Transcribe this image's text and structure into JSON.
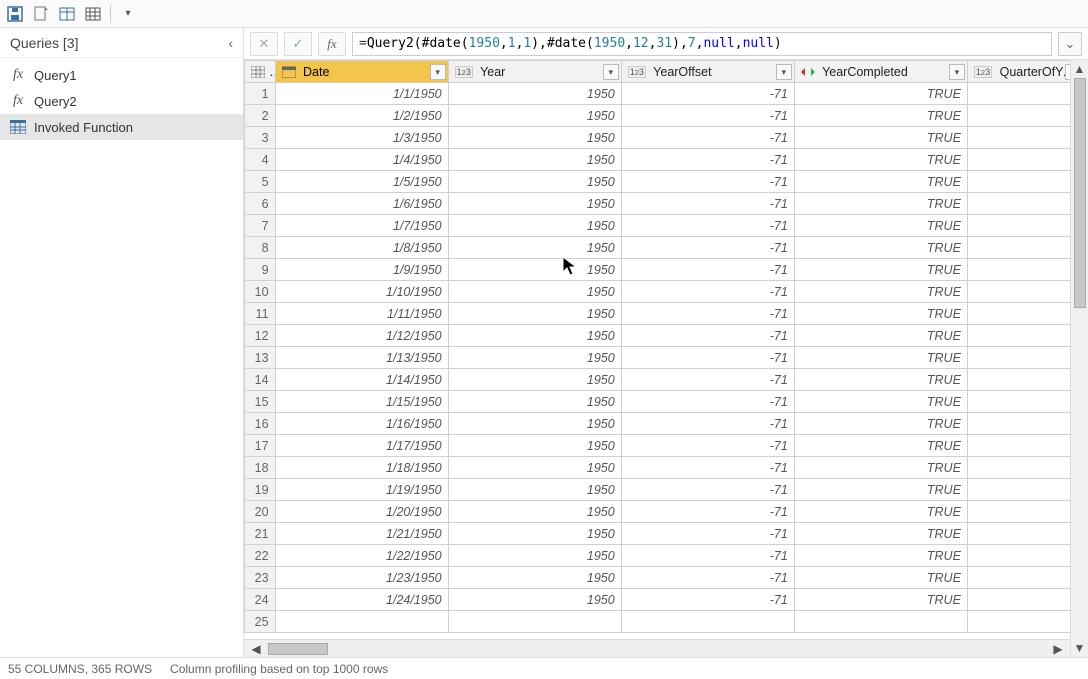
{
  "toolbar": {
    "qat": [
      "save-icon",
      "new-source-icon",
      "enter-data-icon",
      "table-icon",
      "more-icon"
    ]
  },
  "queries_panel": {
    "title": "Queries [3]",
    "items": [
      {
        "label": "Query1",
        "icon": "fx",
        "selected": false
      },
      {
        "label": "Query2",
        "icon": "fx",
        "selected": false
      },
      {
        "label": "Invoked Function",
        "icon": "table",
        "selected": true
      }
    ]
  },
  "formula_bar": {
    "formula_display": "= Query2(#date(1950, 1, 1), #date(1950, 12, 31), 7, null, null)"
  },
  "grid": {
    "columns": [
      {
        "name": "Date",
        "type": "date",
        "selected": true
      },
      {
        "name": "Year",
        "type": "int",
        "selected": false
      },
      {
        "name": "YearOffset",
        "type": "int",
        "selected": false
      },
      {
        "name": "YearCompleted",
        "type": "bool",
        "selected": false
      },
      {
        "name": "QuarterOfYear",
        "type": "int",
        "selected": false
      }
    ],
    "rows": [
      {
        "n": 1,
        "Date": "1/1/1950",
        "Year": "1950",
        "YearOffset": "-71",
        "YearCompleted": "TRUE"
      },
      {
        "n": 2,
        "Date": "1/2/1950",
        "Year": "1950",
        "YearOffset": "-71",
        "YearCompleted": "TRUE"
      },
      {
        "n": 3,
        "Date": "1/3/1950",
        "Year": "1950",
        "YearOffset": "-71",
        "YearCompleted": "TRUE"
      },
      {
        "n": 4,
        "Date": "1/4/1950",
        "Year": "1950",
        "YearOffset": "-71",
        "YearCompleted": "TRUE"
      },
      {
        "n": 5,
        "Date": "1/5/1950",
        "Year": "1950",
        "YearOffset": "-71",
        "YearCompleted": "TRUE"
      },
      {
        "n": 6,
        "Date": "1/6/1950",
        "Year": "1950",
        "YearOffset": "-71",
        "YearCompleted": "TRUE"
      },
      {
        "n": 7,
        "Date": "1/7/1950",
        "Year": "1950",
        "YearOffset": "-71",
        "YearCompleted": "TRUE"
      },
      {
        "n": 8,
        "Date": "1/8/1950",
        "Year": "1950",
        "YearOffset": "-71",
        "YearCompleted": "TRUE"
      },
      {
        "n": 9,
        "Date": "1/9/1950",
        "Year": "1950",
        "YearOffset": "-71",
        "YearCompleted": "TRUE"
      },
      {
        "n": 10,
        "Date": "1/10/1950",
        "Year": "1950",
        "YearOffset": "-71",
        "YearCompleted": "TRUE"
      },
      {
        "n": 11,
        "Date": "1/11/1950",
        "Year": "1950",
        "YearOffset": "-71",
        "YearCompleted": "TRUE"
      },
      {
        "n": 12,
        "Date": "1/12/1950",
        "Year": "1950",
        "YearOffset": "-71",
        "YearCompleted": "TRUE"
      },
      {
        "n": 13,
        "Date": "1/13/1950",
        "Year": "1950",
        "YearOffset": "-71",
        "YearCompleted": "TRUE"
      },
      {
        "n": 14,
        "Date": "1/14/1950",
        "Year": "1950",
        "YearOffset": "-71",
        "YearCompleted": "TRUE"
      },
      {
        "n": 15,
        "Date": "1/15/1950",
        "Year": "1950",
        "YearOffset": "-71",
        "YearCompleted": "TRUE"
      },
      {
        "n": 16,
        "Date": "1/16/1950",
        "Year": "1950",
        "YearOffset": "-71",
        "YearCompleted": "TRUE"
      },
      {
        "n": 17,
        "Date": "1/17/1950",
        "Year": "1950",
        "YearOffset": "-71",
        "YearCompleted": "TRUE"
      },
      {
        "n": 18,
        "Date": "1/18/1950",
        "Year": "1950",
        "YearOffset": "-71",
        "YearCompleted": "TRUE"
      },
      {
        "n": 19,
        "Date": "1/19/1950",
        "Year": "1950",
        "YearOffset": "-71",
        "YearCompleted": "TRUE"
      },
      {
        "n": 20,
        "Date": "1/20/1950",
        "Year": "1950",
        "YearOffset": "-71",
        "YearCompleted": "TRUE"
      },
      {
        "n": 21,
        "Date": "1/21/1950",
        "Year": "1950",
        "YearOffset": "-71",
        "YearCompleted": "TRUE"
      },
      {
        "n": 22,
        "Date": "1/22/1950",
        "Year": "1950",
        "YearOffset": "-71",
        "YearCompleted": "TRUE"
      },
      {
        "n": 23,
        "Date": "1/23/1950",
        "Year": "1950",
        "YearOffset": "-71",
        "YearCompleted": "TRUE"
      },
      {
        "n": 24,
        "Date": "1/24/1950",
        "Year": "1950",
        "YearOffset": "-71",
        "YearCompleted": "TRUE"
      },
      {
        "n": 25,
        "Date": "",
        "Year": "",
        "YearOffset": "",
        "YearCompleted": ""
      }
    ]
  },
  "status_bar": {
    "summary": "55 COLUMNS, 365 ROWS",
    "profiling": "Column profiling based on top 1000 rows"
  }
}
